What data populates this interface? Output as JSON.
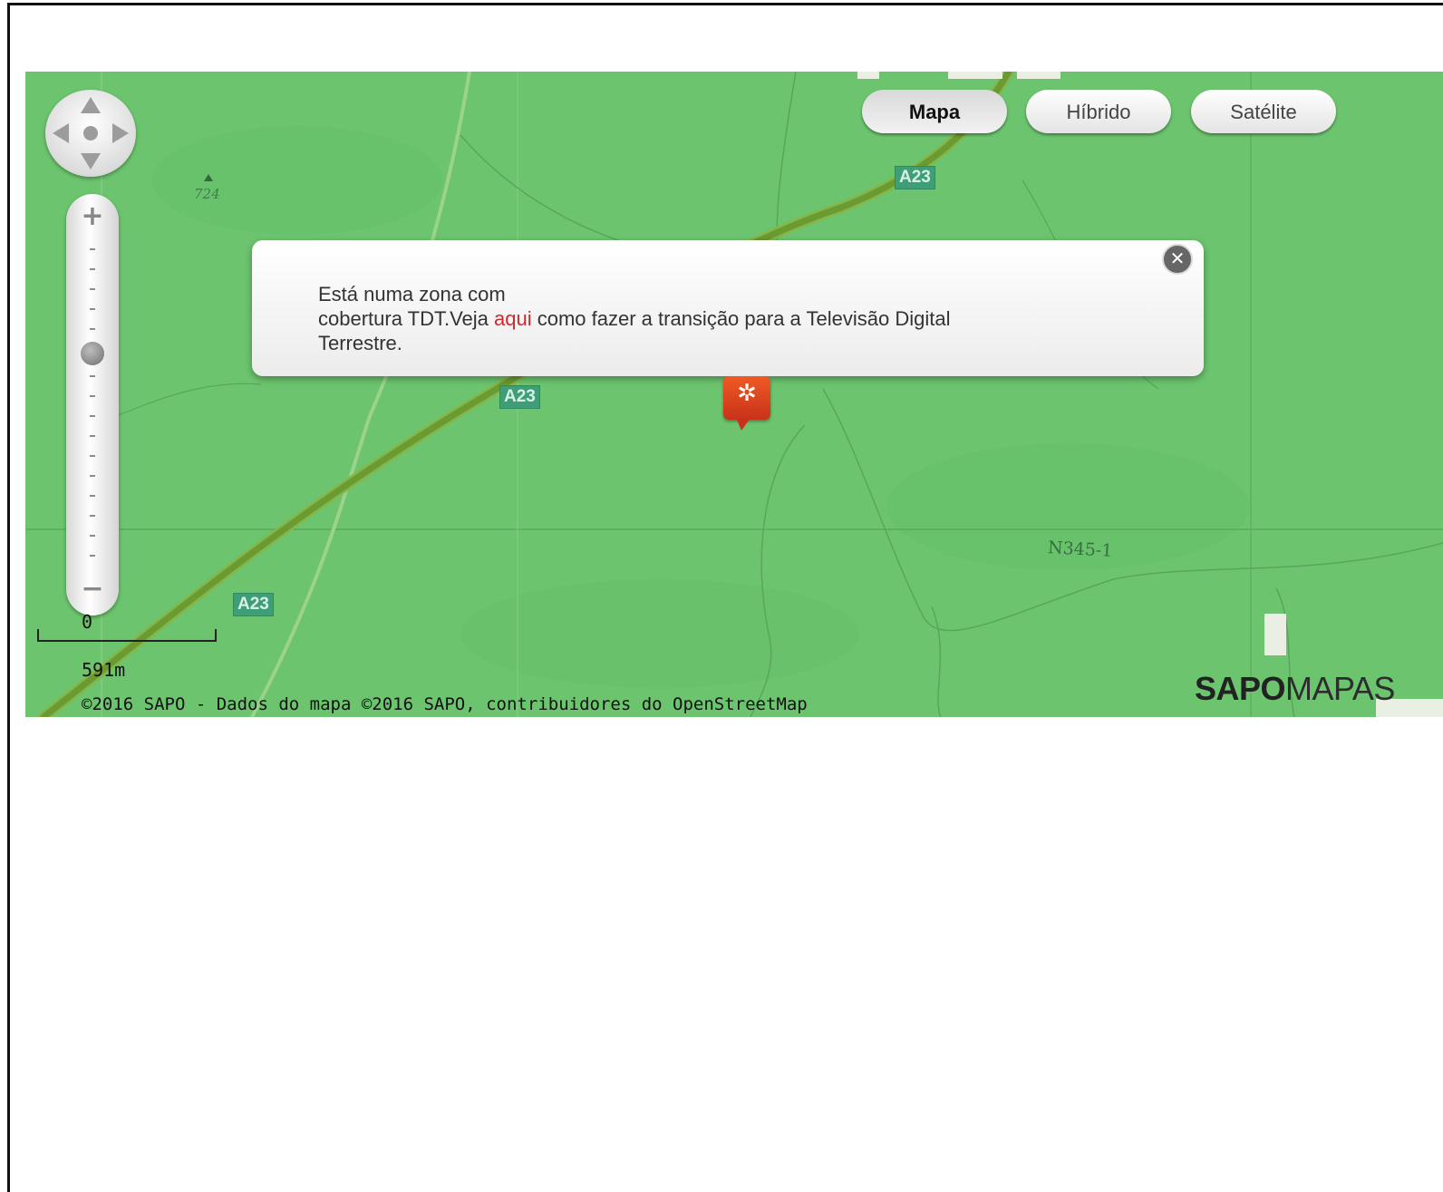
{
  "map_types": {
    "map_label": "Mapa",
    "hybrid_label": "Híbrido",
    "satellite_label": "Satélite",
    "active": "Mapa"
  },
  "popup": {
    "line1": "Está numa zona com",
    "line2_before": "cobertura TDT.Veja ",
    "link_text": "aqui",
    "line2_after": " como fazer a transição para a Televisão Digital",
    "line3": "Terrestre.",
    "close_icon": "close-icon"
  },
  "road_labels": [
    "A23",
    "A23",
    "A23"
  ],
  "national_road": "N345-1",
  "elevation": "724",
  "scale": {
    "zero": "0",
    "distance": "591m"
  },
  "attribution": "©2016 SAPO - Dados do mapa ©2016 SAPO, contribuidores do OpenStreetMap",
  "logo": {
    "bold": "SAPO",
    "light": "MAPAS"
  },
  "zoom": {
    "plus": "+",
    "minus": "−"
  },
  "colors": {
    "map_green": "#6cc56e",
    "highway": "#5c8f2a",
    "link": "#d0282d",
    "marker": "#e2441f"
  }
}
